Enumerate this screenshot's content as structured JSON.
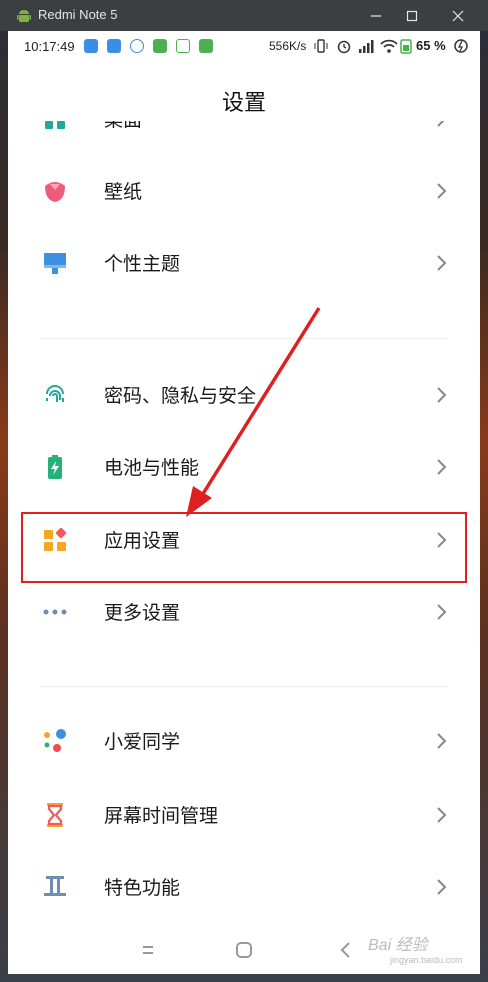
{
  "window": {
    "title": "Redmi Note 5"
  },
  "statusbar": {
    "time": "10:17:49",
    "speed": "556K/s",
    "battery": "65 %"
  },
  "header": {
    "title": "设置"
  },
  "items": [
    {
      "label": "桌面",
      "icon": "desktop-icon"
    },
    {
      "label": "壁纸",
      "icon": "wallpaper-icon"
    },
    {
      "label": "个性主题",
      "icon": "theme-icon"
    },
    {
      "label": "密码、隐私与安全",
      "icon": "fingerprint-icon"
    },
    {
      "label": "电池与性能",
      "icon": "battery-icon"
    },
    {
      "label": "应用设置",
      "icon": "apps-icon"
    },
    {
      "label": "更多设置",
      "icon": "more-icon"
    },
    {
      "label": "小爱同学",
      "icon": "xiaoai-icon"
    },
    {
      "label": "屏幕时间管理",
      "icon": "hourglass-icon"
    },
    {
      "label": "特色功能",
      "icon": "feature-icon"
    }
  ],
  "watermark": {
    "main": "Bai 经验",
    "sub": "jingyan.baidu.com"
  },
  "colors": {
    "highlight": "#e02020",
    "arrow": "#e02020"
  }
}
